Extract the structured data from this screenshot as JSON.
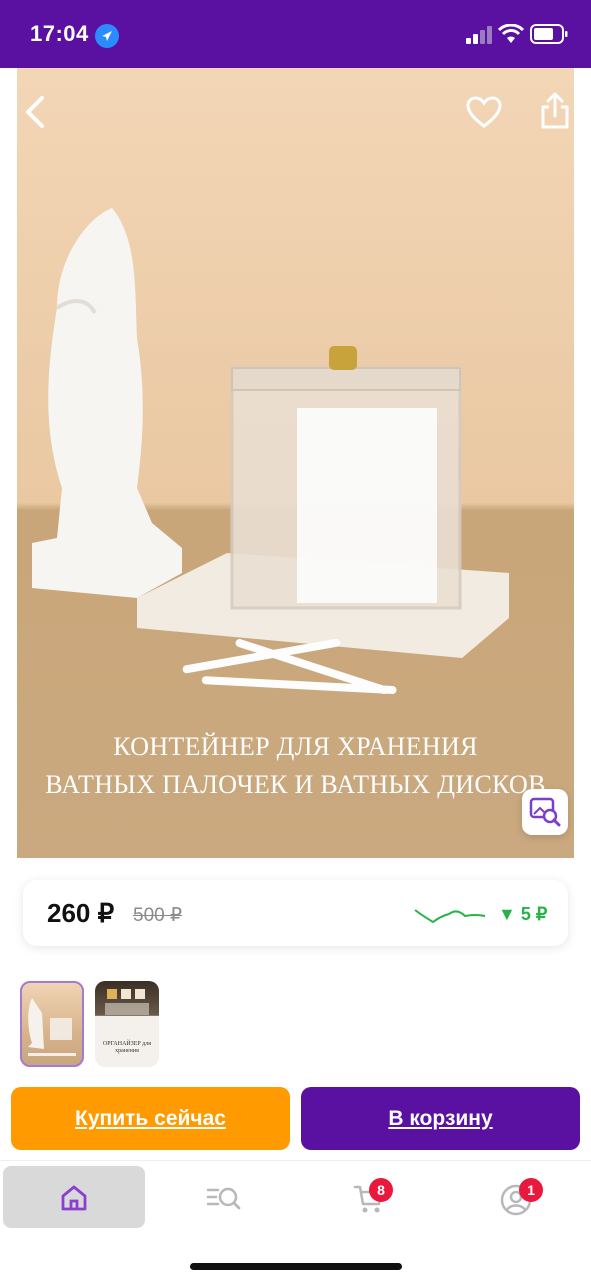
{
  "status_bar": {
    "time": "17:04"
  },
  "product": {
    "image_caption_line1": "КОНТЕЙНЕР ДЛЯ ХРАНЕНИЯ",
    "image_caption_line2": "ВАТНЫХ ПАЛОЧЕК И ВАТНЫХ ДИСКОВ",
    "price": "260 ₽",
    "old_price": "500 ₽",
    "price_drop": "▼ 5 ₽",
    "thumbnail_2_text": "ОРГАНАЙЗЕР для хранения"
  },
  "actions": {
    "buy_now": "Купить сейчас",
    "add_to_cart": "В корзину"
  },
  "tabbar": {
    "cart_badge": "8",
    "profile_badge": "1"
  },
  "colors": {
    "brand_purple": "#5a10a0",
    "buy_orange": "#ff9a00",
    "badge_red": "#e8193c",
    "price_green": "#27b34a"
  }
}
